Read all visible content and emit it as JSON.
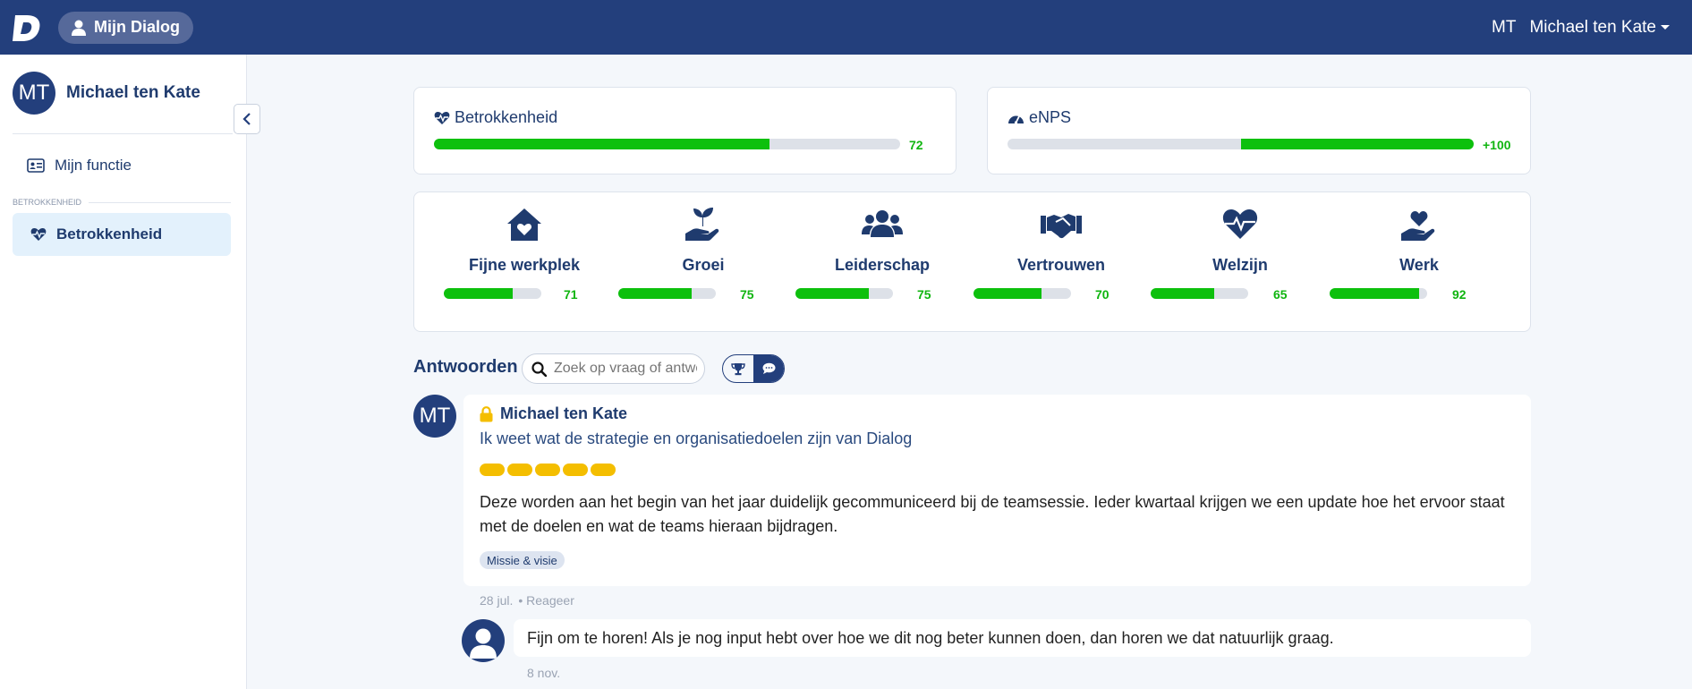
{
  "topbar": {
    "logo_letter": "D",
    "pill_label": "Mijn Dialog",
    "user_initials": "MT",
    "user_name": "Michael ten Kate"
  },
  "sidebar": {
    "user_initials": "MT",
    "user_name": "Michael ten Kate",
    "item_function": "Mijn functie",
    "section_label": "BETROKKENHEID",
    "active_item": "Betrokkenheid"
  },
  "metrics": {
    "engagement": {
      "title": "Betrokkenheid",
      "value": 72,
      "value_label": "72"
    },
    "enps": {
      "title": "eNPS",
      "value": 100,
      "value_label": "+100"
    }
  },
  "categories": [
    {
      "label": "Fijne werkplek",
      "value": 71,
      "value_label": "71",
      "icon": "house-heart-icon"
    },
    {
      "label": "Groei",
      "value": 75,
      "value_label": "75",
      "icon": "plant-hand-icon"
    },
    {
      "label": "Leiderschap",
      "value": 75,
      "value_label": "75",
      "icon": "users-icon"
    },
    {
      "label": "Vertrouwen",
      "value": 70,
      "value_label": "70",
      "icon": "handshake-icon"
    },
    {
      "label": "Welzijn",
      "value": 65,
      "value_label": "65",
      "icon": "heart-pulse-icon"
    },
    {
      "label": "Werk",
      "value": 92,
      "value_label": "92",
      "icon": "hand-heart-icon"
    }
  ],
  "answers": {
    "title": "Antwoorden",
    "search_placeholder": "Zoek op vraag of antwoord"
  },
  "answer": {
    "initials": "MT",
    "name": "Michael ten Kate",
    "question": "Ik weet wat de strategie en organisatiedoelen zijn van Dialog",
    "rating": 5,
    "text": "Deze worden aan het begin van het jaar duidelijk gecommuniceerd bij de teamsessie. Ieder kwartaal krijgen we een update hoe het ervoor staat met de doelen en wat de teams hieraan bijdragen.",
    "tag": "Missie & visie",
    "date": "28 jul.",
    "reply_action": "• Reageer"
  },
  "reply": {
    "text": "Fijn om te horen! Als je nog input hebt over hoe we dit nog beter kunnen doen, dan horen we dat natuurlijk graag.",
    "date": "8 nov."
  },
  "colors": {
    "navy": "#233f7c",
    "green": "#0dc00d",
    "star": "#f4be00",
    "active_bg": "#e3f1fc"
  }
}
